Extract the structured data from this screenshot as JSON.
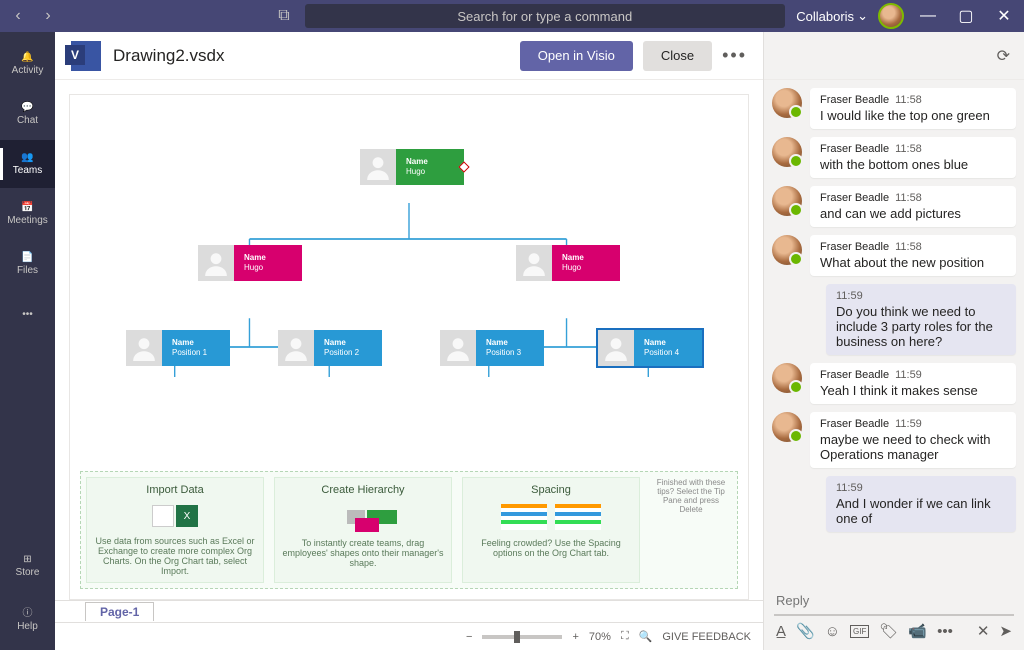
{
  "titlebar": {
    "search_placeholder": "Search for or type a command",
    "org": "Collaboris"
  },
  "rail": {
    "activity": "Activity",
    "chat": "Chat",
    "teams": "Teams",
    "meetings": "Meetings",
    "files": "Files",
    "store": "Store",
    "help": "Help"
  },
  "doc": {
    "title": "Drawing2.vsdx",
    "open": "Open in Visio",
    "close": "Close",
    "page": "Page-1",
    "zoom": "70%",
    "feedback": "GIVE FEEDBACK"
  },
  "org": {
    "top": {
      "name": "Name",
      "sub": "Hugo"
    },
    "l2a": {
      "name": "Name",
      "sub": "Hugo"
    },
    "l2b": {
      "name": "Name",
      "sub": "Hugo"
    },
    "p1": {
      "name": "Name",
      "sub": "Position 1"
    },
    "p2": {
      "name": "Name",
      "sub": "Position 2"
    },
    "p3": {
      "name": "Name",
      "sub": "Position 3"
    },
    "p4": {
      "name": "Name",
      "sub": "Position 4"
    }
  },
  "tips": {
    "t1": {
      "title": "Import Data",
      "body": "Use data from sources such as Excel or Exchange to create more complex Org Charts. On the Org Chart tab, select Import."
    },
    "t2": {
      "title": "Create Hierarchy",
      "body": "To instantly create teams, drag employees' shapes onto their manager's shape."
    },
    "t3": {
      "title": "Spacing",
      "body": "Feeling crowded? Use the Spacing options on the Org Chart tab."
    },
    "close": "Finished with these tips? Select the Tip Pane and press Delete"
  },
  "chat": {
    "msgs": [
      {
        "self": false,
        "name": "Fraser Beadle",
        "time": "11:58",
        "text": "I would like the top one green"
      },
      {
        "self": false,
        "name": "Fraser Beadle",
        "time": "11:58",
        "text": "with the bottom ones blue"
      },
      {
        "self": false,
        "name": "Fraser Beadle",
        "time": "11:58",
        "text": "and can we add pictures"
      },
      {
        "self": false,
        "name": "Fraser Beadle",
        "time": "11:58",
        "text": "What about the new position"
      },
      {
        "self": true,
        "time": "11:59",
        "text": "Do you think we need to include 3 party roles for the business on here?"
      },
      {
        "self": false,
        "name": "Fraser Beadle",
        "time": "11:59",
        "text": "Yeah I think it makes sense"
      },
      {
        "self": false,
        "name": "Fraser Beadle",
        "time": "11:59",
        "text": "maybe we need to check with Operations manager"
      },
      {
        "self": true,
        "time": "11:59",
        "text": "And I wonder if we can link one of"
      }
    ],
    "reply_placeholder": "Reply"
  }
}
